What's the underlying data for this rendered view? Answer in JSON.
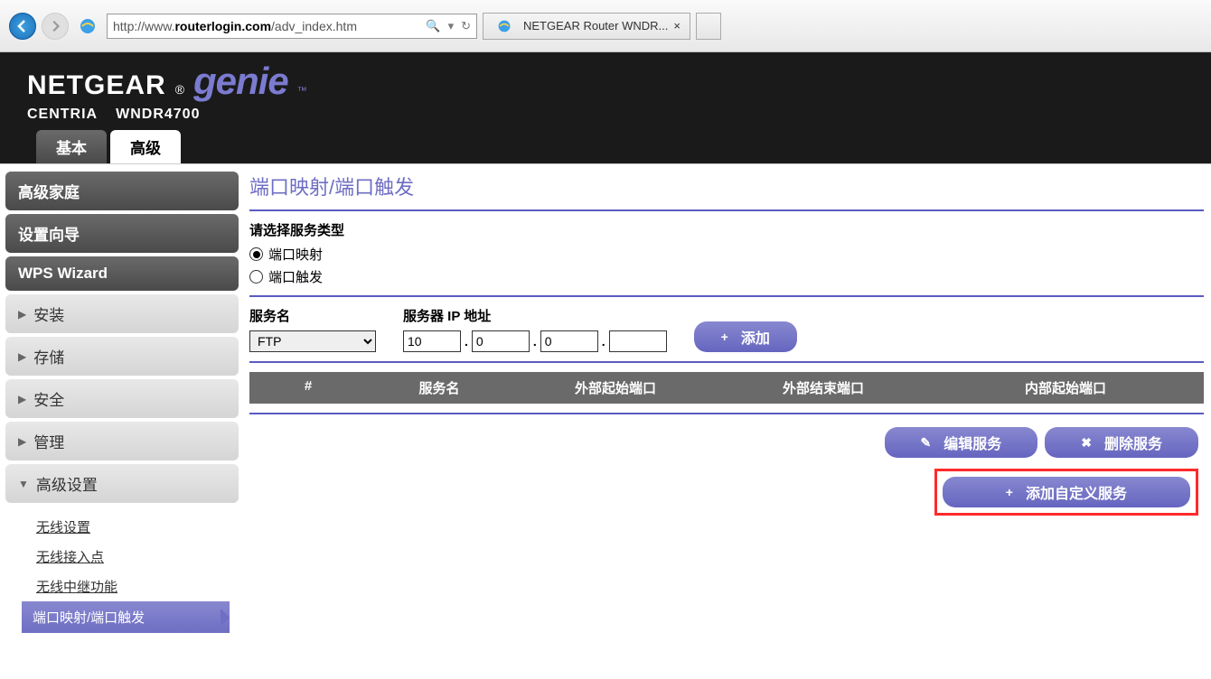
{
  "browser": {
    "url_prefix": "http://www.",
    "url_host": "routerlogin.com",
    "url_path": "/adv_index.htm",
    "search_glyph": "🔍",
    "refresh_glyph": "↻",
    "tab_title": "NETGEAR Router WNDR...",
    "tab_close": "×"
  },
  "header": {
    "brand": "NETGEAR",
    "genie": "genie",
    "subtitle_model": "CENTRIA",
    "subtitle_product": "WNDR4700",
    "tab_basic": "基本",
    "tab_advanced": "高级"
  },
  "sidebar": {
    "items": [
      "高级家庭",
      "设置向导",
      "WPS Wizard",
      "安装",
      "存储",
      "安全",
      "管理",
      "高级设置"
    ],
    "sub": {
      "wireless": "无线设置",
      "ap": "无线接入点",
      "repeater": "无线中继功能",
      "portfwd": "端口映射/端口触发"
    }
  },
  "main": {
    "title": "端口映射/端口触发",
    "select_service_type": "请选择服务类型",
    "radio_forward": "端口映射",
    "radio_trigger": "端口触发",
    "service_name": "服务名",
    "service_selected": "FTP",
    "server_ip": "服务器 IP 地址",
    "ip": {
      "a": "10",
      "b": "0",
      "c": "0",
      "d": ""
    },
    "add": "添加",
    "table": {
      "col1": "#",
      "col2": "服务名",
      "col3": "外部起始端口",
      "col4": "外部结束端口",
      "col5": "内部起始端口"
    },
    "edit_service": "编辑服务",
    "delete_service": "删除服务",
    "add_custom_service": "添加自定义服务"
  }
}
